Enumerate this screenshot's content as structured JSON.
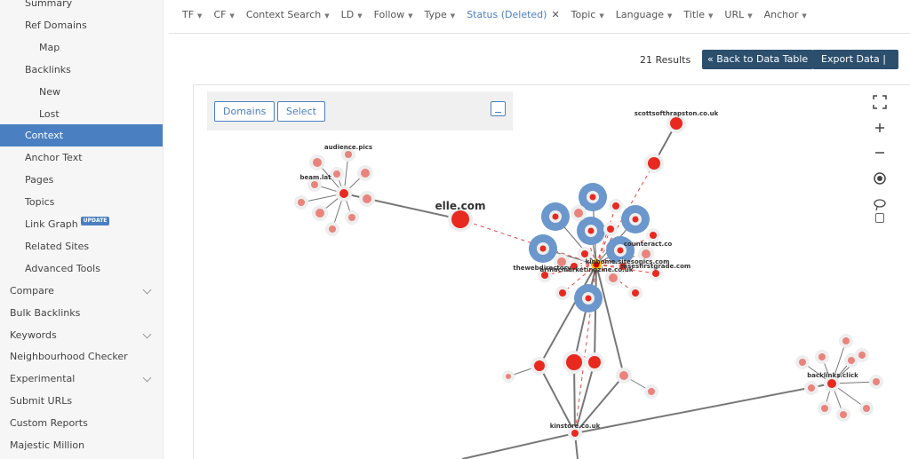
{
  "sidebar": {
    "items": [
      {
        "label": "Summary",
        "level": "sub1"
      },
      {
        "label": "Ref Domains",
        "level": "sub1"
      },
      {
        "label": "Map",
        "level": "sub2"
      },
      {
        "label": "Backlinks",
        "level": "sub1"
      },
      {
        "label": "New",
        "level": "sub2"
      },
      {
        "label": "Lost",
        "level": "sub2"
      },
      {
        "label": "Context",
        "level": "sub1",
        "active": true
      },
      {
        "label": "Anchor Text",
        "level": "sub1"
      },
      {
        "label": "Pages",
        "level": "sub1"
      },
      {
        "label": "Topics",
        "level": "sub1"
      },
      {
        "label": "Link Graph",
        "level": "sub1",
        "badge": "UPDATE"
      },
      {
        "label": "Related Sites",
        "level": "sub1"
      },
      {
        "label": "Advanced Tools",
        "level": "sub1"
      },
      {
        "label": "Compare",
        "level": "top",
        "expandable": true
      },
      {
        "label": "Bulk Backlinks",
        "level": "top"
      },
      {
        "label": "Keywords",
        "level": "top",
        "expandable": true
      },
      {
        "label": "Neighbourhood Checker",
        "level": "top"
      },
      {
        "label": "Experimental",
        "level": "top",
        "expandable": true
      },
      {
        "label": "Submit URLs",
        "level": "top"
      },
      {
        "label": "Custom Reports",
        "level": "top"
      },
      {
        "label": "Majestic Million",
        "level": "top"
      }
    ]
  },
  "filters": [
    {
      "label": "TF"
    },
    {
      "label": "CF"
    },
    {
      "label": "Context Search"
    },
    {
      "label": "LD"
    },
    {
      "label": "Follow"
    },
    {
      "label": "Type"
    },
    {
      "label": "Status (Deleted)",
      "active": true
    },
    {
      "label": "Topic"
    },
    {
      "label": "Language"
    },
    {
      "label": "Title"
    },
    {
      "label": "URL"
    },
    {
      "label": "Anchor"
    }
  ],
  "toolbar": {
    "results": "21 Results",
    "back_label": "« Back to Data Table",
    "export_label": "Export Data |",
    "export_caret": "▾"
  },
  "graph_panel": {
    "domains_label": "Domains",
    "select_label": "Select"
  },
  "graph_controls": [
    "fullscreen-icon",
    "zoom-in-icon",
    "zoom-out-icon",
    "center-target-icon",
    "lasso-icon",
    "checkbox"
  ],
  "graph_labels": {
    "scotts": "scottsofthrapston.co.uk",
    "elle": "elle.com",
    "audience": "audience.pics",
    "beam": "beam.lat",
    "counteract": "counteract.co",
    "kinhome": "kinhome.sitesonics.com",
    "mses": "msesfirstgrade.com",
    "webdir": "thewebdirectory",
    "armac": "armacmarketingzine.co.uk",
    "kinstore": "kinstore.co.uk",
    "backlinks": "backlinks.click"
  },
  "colors": {
    "accent": "#4a7fc1",
    "button_dark": "#2c4f6e",
    "node_red": "#e8291f",
    "node_pink": "#e8847c",
    "node_blue": "#6b97cc",
    "hub": "#f5c400"
  }
}
